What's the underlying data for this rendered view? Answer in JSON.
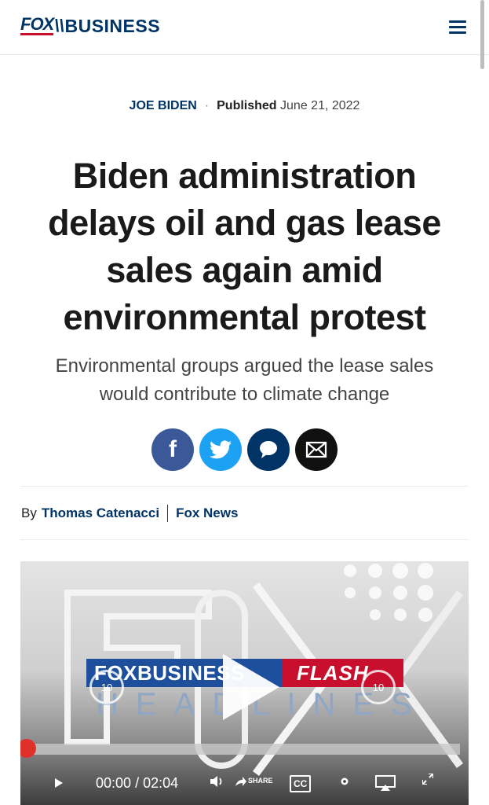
{
  "header": {
    "logo_fox": "FOX",
    "logo_business": "BUSINESS",
    "menu_icon": "hamburger-menu-icon"
  },
  "article": {
    "category": "JOE BIDEN",
    "published_label": "Published",
    "published_date": "June 21, 2022",
    "headline": "Biden administration delays oil and gas lease sales again amid environmental protest",
    "subheadline": "Environmental groups argued the lease sales would contribute to climate change",
    "byline_prefix": "By",
    "author": "Thomas Catenacci",
    "outlet": "Fox News"
  },
  "share": {
    "facebook_glyph": "f",
    "icons": [
      "facebook-icon",
      "twitter-icon",
      "flipboard-comment-icon",
      "email-icon"
    ]
  },
  "video": {
    "brand_left": "FOXBUSINESS",
    "brand_right": "FLASH",
    "subtitle": "HEADLINES",
    "seek_seconds": "10",
    "current_time": "00:00",
    "time_separator": "/",
    "duration": "02:04",
    "share_label": "SHARE",
    "cc_label": "CC",
    "progress": 0.0
  },
  "colors": {
    "brand_navy": "#003366",
    "brand_red": "#c8102e",
    "facebook": "#3b5998",
    "twitter": "#1da1f2",
    "progress_knob": "#e0302a"
  }
}
